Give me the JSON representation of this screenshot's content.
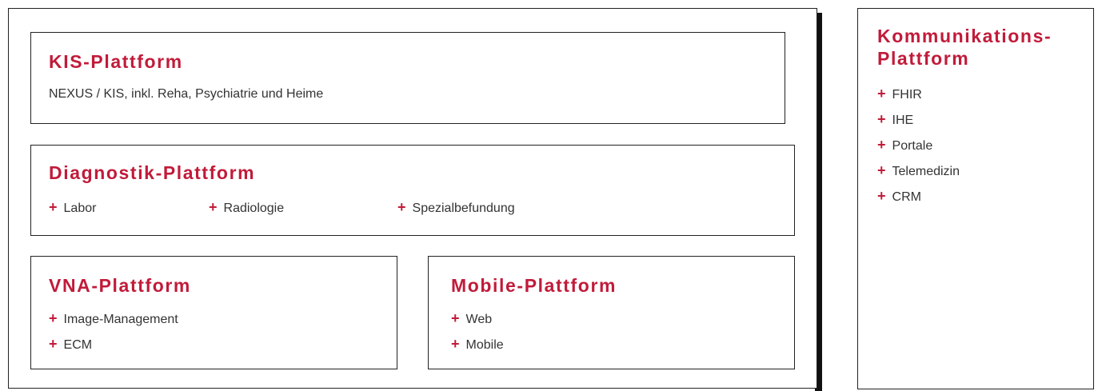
{
  "kis": {
    "title": "KIS-Plattform",
    "description": "NEXUS / KIS, inkl. Reha, Psychiatrie und Heime"
  },
  "diagnostik": {
    "title": "Diagnostik-Plattform",
    "items": [
      "Labor",
      "Radiologie",
      "Spezialbefundung"
    ]
  },
  "vna": {
    "title": "VNA-Plattform",
    "items": [
      "Image-Management",
      "ECM"
    ]
  },
  "mobile": {
    "title": "Mobile-Plattform",
    "items": [
      "Web",
      "Mobile"
    ]
  },
  "kommunikation": {
    "title_line1": "Kommunikations-",
    "title_line2": "Plattform",
    "items": [
      "FHIR",
      "IHE",
      "Portale",
      "Telemedizin",
      "CRM"
    ]
  },
  "bullet": "+",
  "colors": {
    "accent": "#c11b3a",
    "border": "#222222",
    "text": "#333333"
  }
}
